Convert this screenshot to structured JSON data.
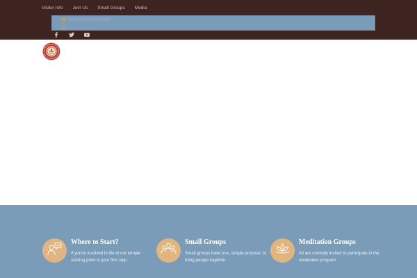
{
  "nav": {
    "items": [
      {
        "label": "Visitor Info"
      },
      {
        "label": "Join Us"
      },
      {
        "label": "Small Groups"
      },
      {
        "label": "Media"
      }
    ]
  },
  "topbar": {
    "background": "#3e2420",
    "info_background": "#7b9cb8",
    "icons": [
      "mail-icon",
      "phone-icon"
    ]
  },
  "social": {
    "icons": [
      "facebook-icon",
      "twitter-icon",
      "youtube-icon"
    ]
  },
  "logo": {
    "icon": "temple-logo"
  },
  "features": {
    "background": "#7b9cb8",
    "circle_color": "#e0b57f",
    "items": [
      {
        "title": "Where to Start?",
        "text": "If you're involved in life at our temple starting point is your first step.",
        "icon": "people-speech-icon"
      },
      {
        "title": "Small Groups",
        "text": "Small groups have one, simple purpose: to bring people together.",
        "icon": "group-icon"
      },
      {
        "title": "Meditation Groups",
        "text": "All are cordially invited to participate in the meditation program",
        "icon": "lotus-icon"
      }
    ]
  }
}
